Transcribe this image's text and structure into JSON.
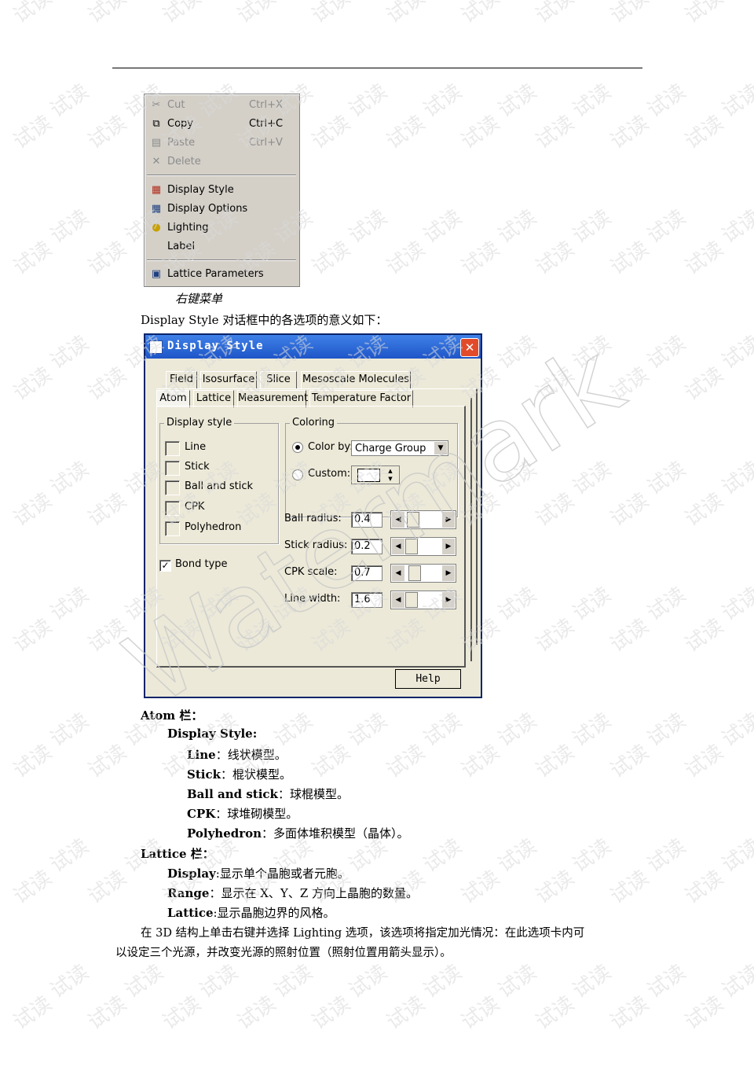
{
  "context_menu": {
    "items": [
      {
        "icon": "scissors-icon",
        "label": "Cut",
        "shortcut": "Ctrl+X",
        "disabled": true
      },
      {
        "icon": "copy-icon",
        "label": "Copy",
        "shortcut": "Ctrl+C",
        "disabled": false
      },
      {
        "icon": "paste-icon",
        "label": "Paste",
        "shortcut": "Ctrl+V",
        "disabled": true
      },
      {
        "icon": "delete-icon",
        "label": "Delete",
        "shortcut": "",
        "disabled": true
      },
      {
        "icon": "display-style-icon",
        "label": "Display Style",
        "shortcut": "",
        "disabled": false
      },
      {
        "icon": "display-options-icon",
        "label": "Display Options",
        "shortcut": "",
        "disabled": false
      },
      {
        "icon": "lightbulb-icon",
        "label": "Lighting",
        "shortcut": "",
        "disabled": false
      },
      {
        "icon": "",
        "label": "Label",
        "shortcut": "",
        "disabled": false
      },
      {
        "icon": "lattice-icon",
        "label": "Lattice Parameters",
        "shortcut": "",
        "disabled": false
      }
    ]
  },
  "caption": "右键菜单",
  "intro": "Display Style 对话框中的各选项的意义如下：",
  "dialog": {
    "title": "Display Style",
    "close_glyph": "✕",
    "tabs_row1": [
      "Field",
      "Isosurface",
      "Slice",
      "Mesoscale Molecules"
    ],
    "tabs_row2": [
      "Atom",
      "Lattice",
      "Measurement",
      "Temperature Factor"
    ],
    "display_style_group": "Display style",
    "display_styles": [
      "Line",
      "Stick",
      "Ball and stick",
      "CPK",
      "Polyhedron"
    ],
    "bond_type_label": "Bond type",
    "bond_type_checked": true,
    "coloring_group": "Coloring",
    "color_by_label": "Color by:",
    "color_by_value": "Charge Group",
    "custom_label": "Custom:",
    "params": [
      {
        "label": "Ball radius:",
        "value": "0.4"
      },
      {
        "label": "Stick radius:",
        "value": "0.2"
      },
      {
        "label": "CPK scale:",
        "value": "0.7"
      },
      {
        "label": "Line width:",
        "value": "1.6"
      }
    ],
    "help_label": "Help"
  },
  "body": {
    "atom_head": "Atom 栏：",
    "display_style_head": "Display Style:",
    "items": [
      {
        "term": "Line",
        "desc": "：线状模型。"
      },
      {
        "term": "Stick",
        "desc": "：棍状模型。"
      },
      {
        "term": "Ball and stick",
        "desc": "：球棍模型。"
      },
      {
        "term": "CPK",
        "desc": "：球堆砌模型。"
      },
      {
        "term": "Polyhedron",
        "desc": "：多面体堆积模型（晶体）。"
      }
    ],
    "lattice_head": "Lattice 栏：",
    "lattice_items": [
      {
        "term": "Display",
        "desc": ":显示单个晶胞或者元胞。"
      },
      {
        "term": "Range",
        "desc": "：显示在 X、Y、Z 方向上晶胞的数量。"
      },
      {
        "term": "Lattice",
        "desc": ":显示晶胞边界的风格。"
      }
    ],
    "para_line1": "在 3D 结构上单击右键并选择 Lighting 选项，该选项将指定加光情况：在此选项卡内可",
    "para_line2": "以设定三个光源，并改变光源的照射位置（照射位置用箭头显示）。"
  },
  "watermark": {
    "tile_text": "试读",
    "diagonal_text": "Watermark"
  }
}
